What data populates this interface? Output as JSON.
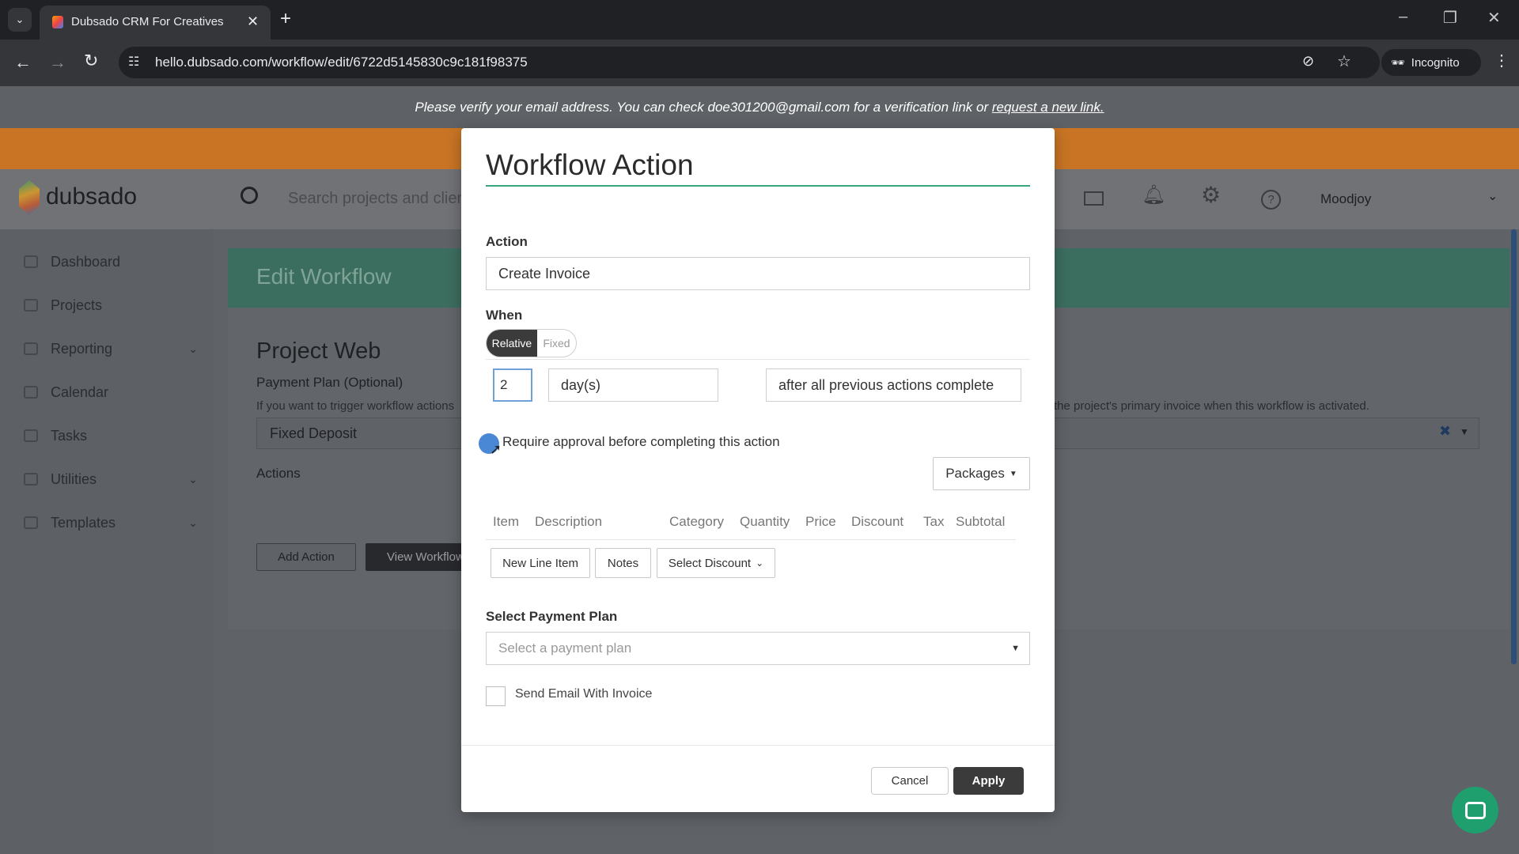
{
  "browser": {
    "tab_title": "Dubsado CRM For Creatives",
    "url": "hello.dubsado.com/workflow/edit/6722d5145830c9c181f98375",
    "incognito_label": "Incognito"
  },
  "banner": {
    "text": "Please verify your email address. You can check doe301200@gmail.com for a verification link or ",
    "link": "request a new link."
  },
  "header": {
    "logo": "dubsado",
    "search_placeholder": "Search projects and clien",
    "user": "Moodjoy"
  },
  "sidebar": {
    "items": [
      {
        "label": "Dashboard"
      },
      {
        "label": "Projects"
      },
      {
        "label": "Reporting"
      },
      {
        "label": "Calendar"
      },
      {
        "label": "Tasks"
      },
      {
        "label": "Utilities"
      },
      {
        "label": "Templates"
      }
    ]
  },
  "edit": {
    "title": "Edit Workflow",
    "project": "Project Web",
    "payment_plan_label": "Payment Plan (Optional)",
    "payment_hint_left": "If you want to trigger workflow actions",
    "payment_hint_right": "the project's primary invoice when this workflow is activated.",
    "payment_value": "Fixed Deposit",
    "actions_label": "Actions",
    "add_action": "Add Action",
    "view_workflow": "View Workflow"
  },
  "modal": {
    "title": "Workflow Action",
    "action_label": "Action",
    "action_value": "Create Invoice",
    "when_label": "When",
    "toggle_relative": "Relative",
    "toggle_fixed": "Fixed",
    "amount": "2",
    "unit": "day(s)",
    "relation": "after all previous actions complete",
    "require_approval": "Require approval before completing this action",
    "packages": "Packages",
    "columns": [
      "Item",
      "Description",
      "Category",
      "Quantity",
      "Price",
      "Discount",
      "Tax",
      "Subtotal"
    ],
    "new_line_item": "New Line Item",
    "notes": "Notes",
    "select_discount": "Select Discount",
    "payment_plan_label": "Select Payment Plan",
    "payment_plan_placeholder": "Select a payment plan",
    "send_email": "Send Email With Invoice",
    "cancel": "Cancel",
    "apply": "Apply"
  },
  "colors": {
    "accent": "#3aa57a",
    "orange": "#e8892a",
    "dark": "#3b3b3b"
  }
}
